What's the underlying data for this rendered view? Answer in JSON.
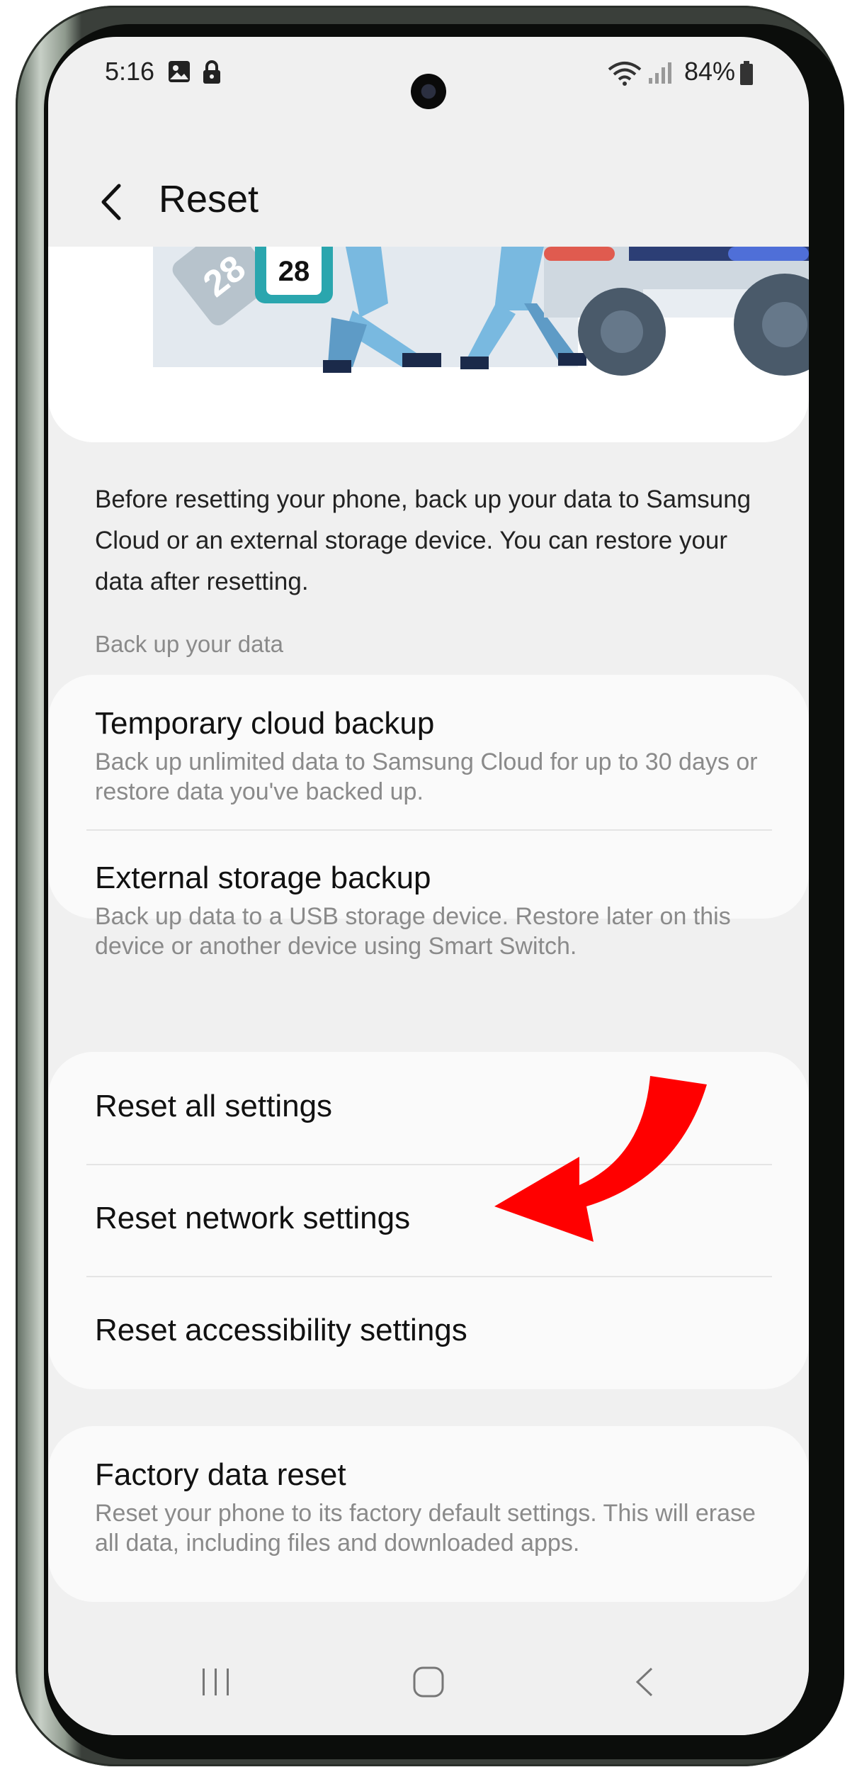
{
  "status": {
    "time": "5:16",
    "battery": "84%"
  },
  "header": {
    "title": "Reset"
  },
  "banner": {
    "calendar_number": "28"
  },
  "intro_text": "Before resetting your phone, back up your data to Samsung Cloud or an external storage device. You can restore your data after resetting.",
  "backup_section": {
    "label": "Back up your data",
    "items": [
      {
        "title": "Temporary cloud backup",
        "subtitle": "Back up unlimited data to Samsung Cloud for up to 30 days or restore data you've backed up."
      },
      {
        "title": "External storage backup",
        "subtitle": "Back up data to a USB storage device. Restore later on this device or another device using Smart Switch."
      }
    ]
  },
  "reset_section": {
    "items": [
      {
        "title": "Reset all settings"
      },
      {
        "title": "Reset network settings"
      },
      {
        "title": "Reset accessibility settings"
      }
    ]
  },
  "factory_section": {
    "title": "Factory data reset",
    "subtitle": "Reset your phone to its factory default settings. This will erase all data, including files and downloaded apps."
  },
  "colors": {
    "background": "#f0f0f0",
    "card": "#fafafa",
    "annotation_arrow": "#ff0000",
    "secondary_text": "#8a8a8a"
  },
  "icons": [
    "back-arrow-icon",
    "gallery-icon",
    "lock-icon",
    "wifi-icon",
    "signal-icon",
    "battery-icon",
    "recent-apps-icon",
    "home-icon",
    "nav-back-icon"
  ]
}
